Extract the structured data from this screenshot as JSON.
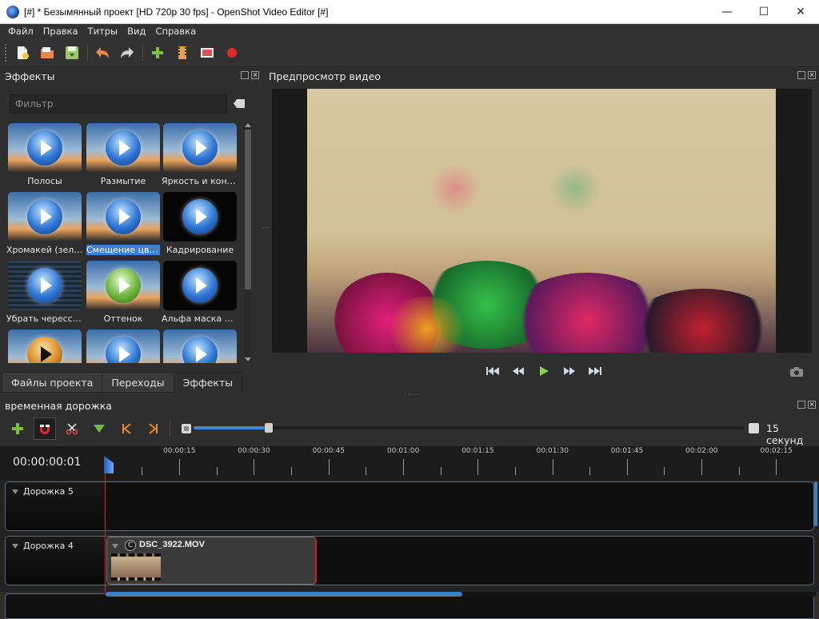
{
  "window": {
    "title": "[#] * Безымянный проект [HD 720p 30 fps] - OpenShot Video Editor [#]",
    "minimize": "—",
    "maximize": "☐",
    "close": "✕"
  },
  "menu": [
    "Файл",
    "Правка",
    "Титры",
    "Вид",
    "Справка"
  ],
  "toolbar": {
    "icons": [
      "new-project-icon",
      "open-project-icon",
      "save-project-icon",
      "undo-icon",
      "redo-icon",
      "import-files-icon",
      "export-film-icon",
      "fullscreen-icon",
      "record-icon"
    ]
  },
  "effects_panel": {
    "title": "Эффекты",
    "filter_placeholder": "Фильтр",
    "items": [
      {
        "label": "Полосы",
        "style": "blue"
      },
      {
        "label": "Размытие",
        "style": "blur"
      },
      {
        "label": "Яркость и конт...",
        "style": "bright"
      },
      {
        "label": "Хромакей (зеле...",
        "style": "blue"
      },
      {
        "label": "Смещение цвета",
        "style": "blue",
        "selected": true
      },
      {
        "label": "Кадрирование",
        "style": "dark"
      },
      {
        "label": "Убрать чересст...",
        "style": "stripes"
      },
      {
        "label": "Оттенок",
        "style": "green"
      },
      {
        "label": "Альфа маска и ...",
        "style": "dark"
      },
      {
        "label": "",
        "style": "orange"
      },
      {
        "label": "",
        "style": "blue"
      },
      {
        "label": "",
        "style": "blue"
      }
    ]
  },
  "tabs": [
    {
      "label": "Файлы проекта",
      "active": false
    },
    {
      "label": "Переходы",
      "active": false
    },
    {
      "label": "Эффекты",
      "active": true
    }
  ],
  "preview": {
    "title": "Предпросмотр видео"
  },
  "timeline": {
    "title": "временная дорожка",
    "timecode": "00:00:00:01",
    "zoom_label": "15 секунд",
    "zoom_fraction": 0.13,
    "ticks": [
      "00:00:15",
      "00:00:30",
      "00:00:45",
      "00:01:00",
      "00:01:15",
      "00:01:30",
      "00:01:45",
      "00:02:00",
      "00:02:15"
    ],
    "tracks": [
      {
        "name": "Дорожка 5"
      },
      {
        "name": "Дорожка 4"
      }
    ],
    "clip": {
      "title": "DSC_3922.MOV",
      "badge": "C"
    }
  },
  "colors": {
    "accent": "#3d7fd6",
    "playhead": "#e02424",
    "background": "#2e2e2e"
  }
}
